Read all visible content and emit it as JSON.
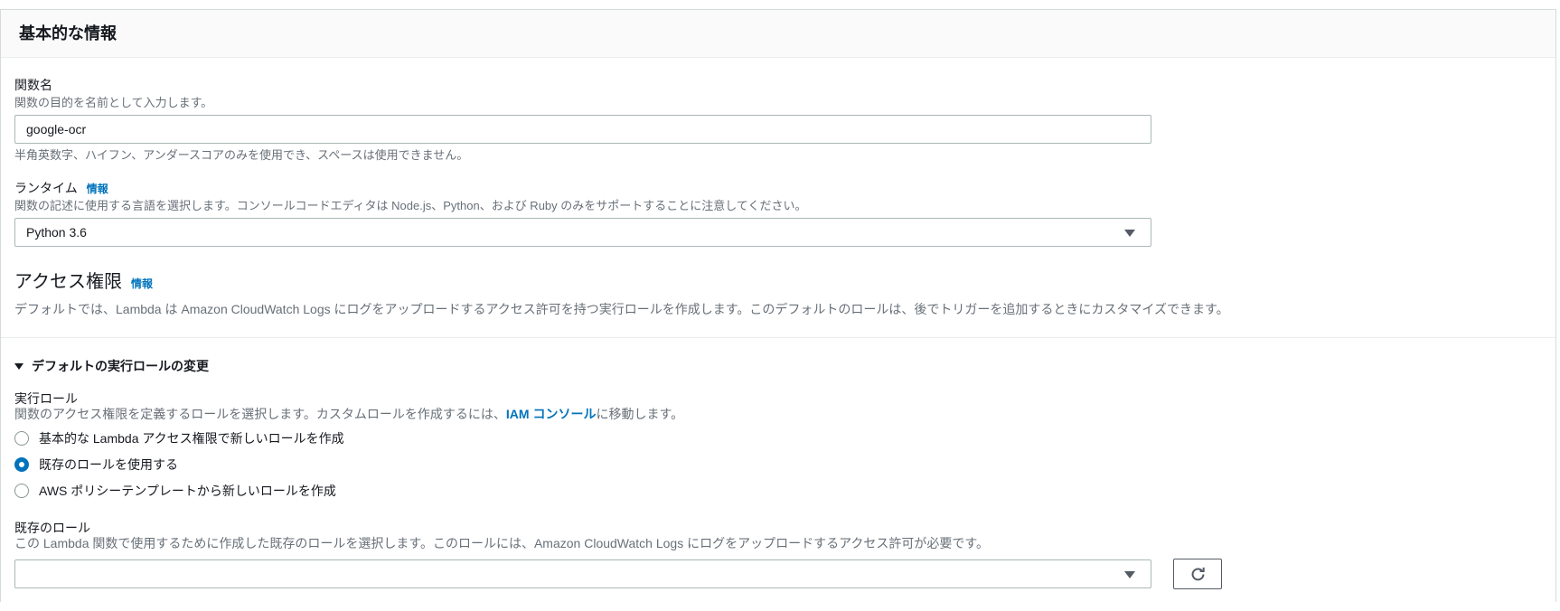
{
  "panel": {
    "title": "基本的な情報"
  },
  "function_name": {
    "label": "関数名",
    "description": "関数の目的を名前として入力します。",
    "value": "google-ocr",
    "constraint": "半角英数字、ハイフン、アンダースコアのみを使用でき、スペースは使用できません。"
  },
  "runtime": {
    "label": "ランタイム",
    "info_link": "情報",
    "description": "関数の記述に使用する言語を選択します。コンソールコードエディタは Node.js、Python、および Ruby のみをサポートすることに注意してください。",
    "selected": "Python 3.6"
  },
  "permissions": {
    "heading": "アクセス権限",
    "info_link": "情報",
    "description": "デフォルトでは、Lambda は Amazon CloudWatch Logs にログをアップロードするアクセス許可を持つ実行ロールを作成します。このデフォルトのロールは、後でトリガーを追加するときにカスタマイズできます。"
  },
  "role_expander": {
    "label": "デフォルトの実行ロールの変更"
  },
  "execution_role": {
    "label": "実行ロール",
    "description_before_link": "関数のアクセス権限を定義するロールを選択します。カスタムロールを作成するには、",
    "link": "IAM コンソール",
    "description_after_link": "に移動します。",
    "options": [
      {
        "label": "基本的な Lambda アクセス権限で新しいロールを作成",
        "selected": false
      },
      {
        "label": "既存のロールを使用する",
        "selected": true
      },
      {
        "label": "AWS ポリシーテンプレートから新しいロールを作成",
        "selected": false
      }
    ]
  },
  "existing_role": {
    "label": "既存のロール",
    "description": "この Lambda 関数で使用するために作成した既存のロールを選択します。このロールには、Amazon CloudWatch Logs にログをアップロードするアクセス許可が必要です。",
    "selected": ""
  },
  "colors": {
    "link": "#0073bb",
    "radio_selected": "#0073bb",
    "field_border": "#aab7b8"
  }
}
